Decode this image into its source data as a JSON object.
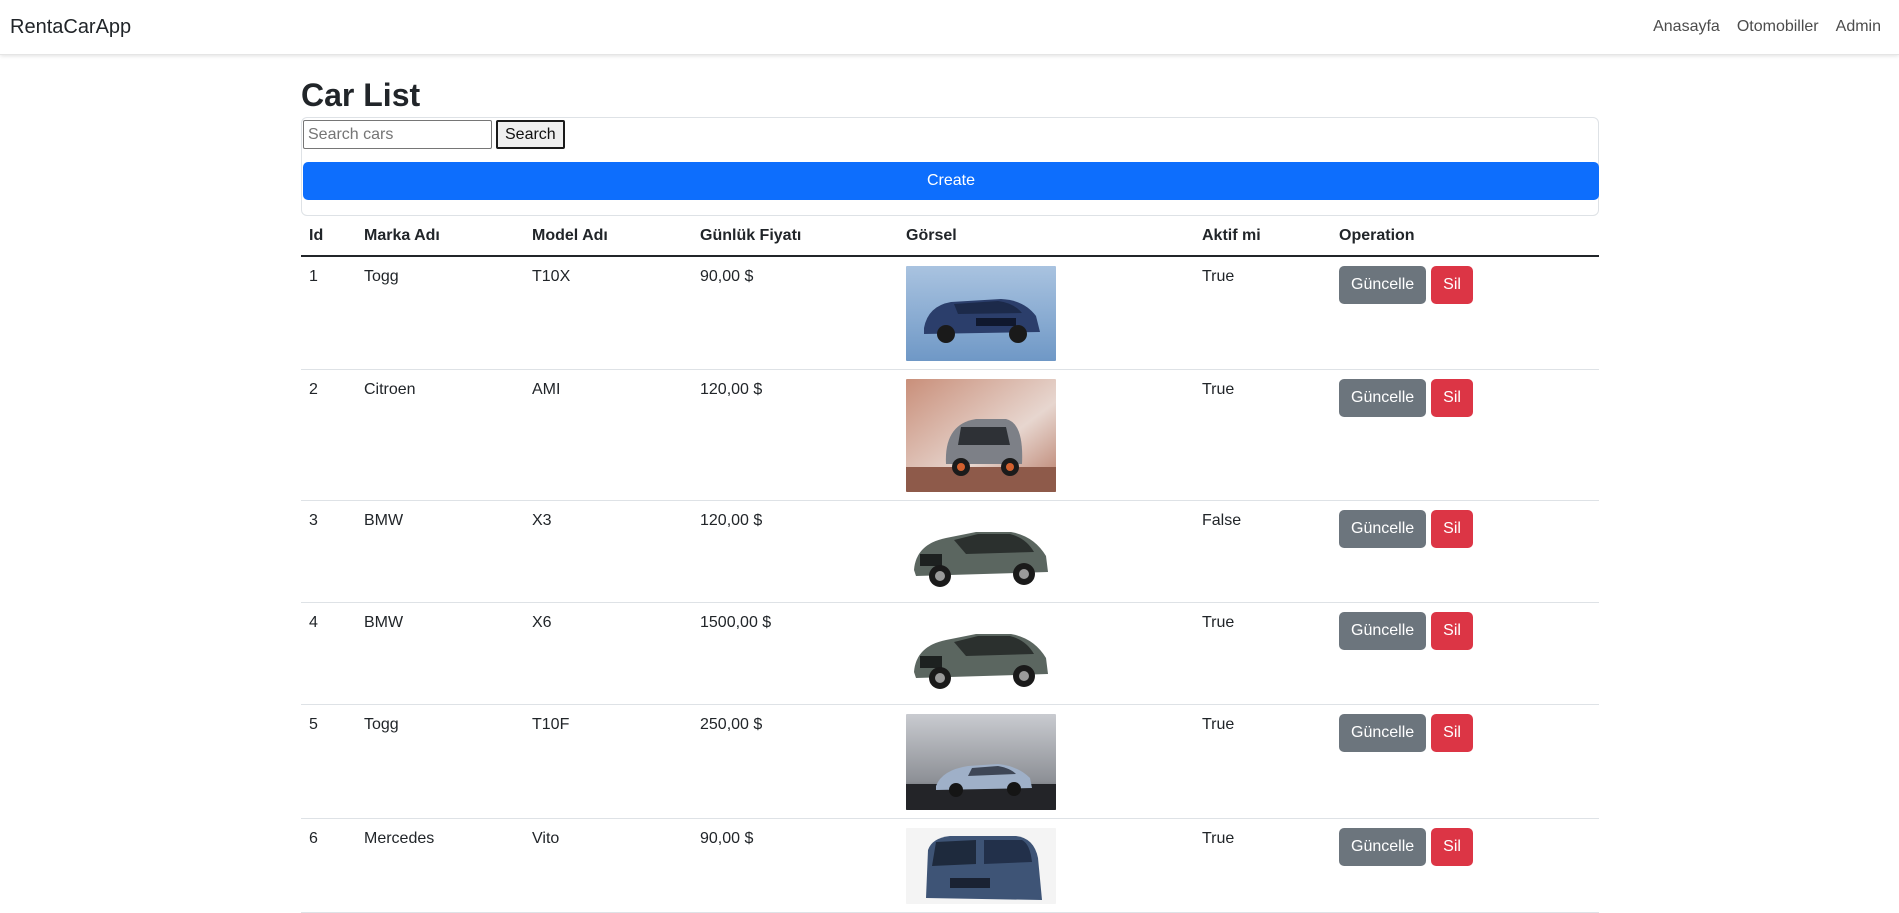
{
  "nav": {
    "brand": "RentaCarApp",
    "links": [
      "Anasayfa",
      "Otomobiller",
      "Admin"
    ]
  },
  "page": {
    "title": "Car List",
    "search_placeholder": "Search cars",
    "search_label": "Search",
    "create_label": "Create"
  },
  "table": {
    "headers": [
      "Id",
      "Marka Adı",
      "Model Adı",
      "Günlük Fiyatı",
      "Görsel",
      "Aktif mi",
      "Operation"
    ],
    "update_label": "Güncelle",
    "delete_label": "Sil",
    "rows": [
      {
        "id": "1",
        "brand": "Togg",
        "model": "T10X",
        "price": "90,00 $",
        "active": "True",
        "image": "blue-suv-photo"
      },
      {
        "id": "2",
        "brand": "Citroen",
        "model": "AMI",
        "price": "120,00 $",
        "active": "True",
        "image": "grey-microcar-photo"
      },
      {
        "id": "3",
        "brand": "BMW",
        "model": "X3",
        "price": "120,00 $",
        "active": "False",
        "image": "green-suv-photo"
      },
      {
        "id": "4",
        "brand": "BMW",
        "model": "X6",
        "price": "1500,00 $",
        "active": "True",
        "image": "green-suv-photo"
      },
      {
        "id": "5",
        "brand": "Togg",
        "model": "T10F",
        "price": "250,00 $",
        "active": "True",
        "image": "silver-sedan-photo"
      },
      {
        "id": "6",
        "brand": "Mercedes",
        "model": "Vito",
        "price": "90,00 $",
        "active": "True",
        "image": "blue-van-photo"
      }
    ]
  },
  "colors": {
    "primary": "#0d6efd",
    "secondary": "#6c757d",
    "danger": "#dc3545"
  }
}
